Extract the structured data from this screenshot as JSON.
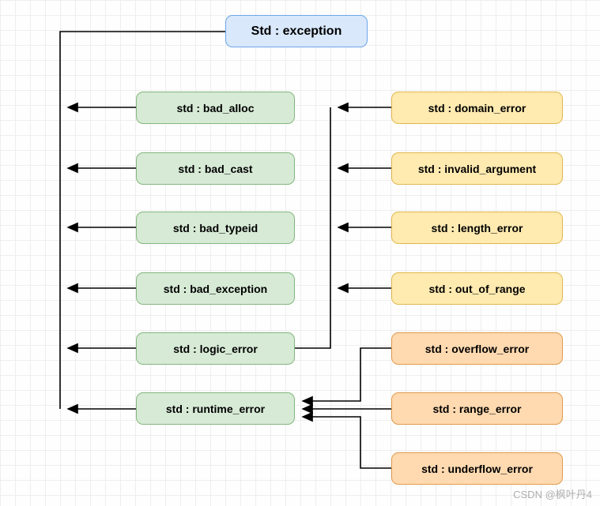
{
  "root": {
    "label": "Std : exception"
  },
  "level1": [
    {
      "label": "std : bad_alloc"
    },
    {
      "label": "std : bad_cast"
    },
    {
      "label": "std : bad_typeid"
    },
    {
      "label": "std : bad_exception"
    },
    {
      "label": "std : logic_error"
    },
    {
      "label": "std : runtime_error"
    }
  ],
  "logic_children": [
    {
      "label": "std : domain_error"
    },
    {
      "label": "std : invalid_argument"
    },
    {
      "label": "std : length_error"
    },
    {
      "label": "std : out_of_range"
    }
  ],
  "runtime_children": [
    {
      "label": "std : overflow_error"
    },
    {
      "label": "std : range_error"
    },
    {
      "label": "std : underflow_error"
    }
  ],
  "watermark": "CSDN @枫叶丹4",
  "colors": {
    "blue_fill": "#d9e8fb",
    "blue_stroke": "#6da6e8",
    "green_fill": "#d6ead5",
    "green_stroke": "#84b77e",
    "yellow_fill": "#ffeab0",
    "yellow_stroke": "#e0b84e",
    "orange_fill": "#ffd9b0",
    "orange_stroke": "#e09a4e"
  }
}
